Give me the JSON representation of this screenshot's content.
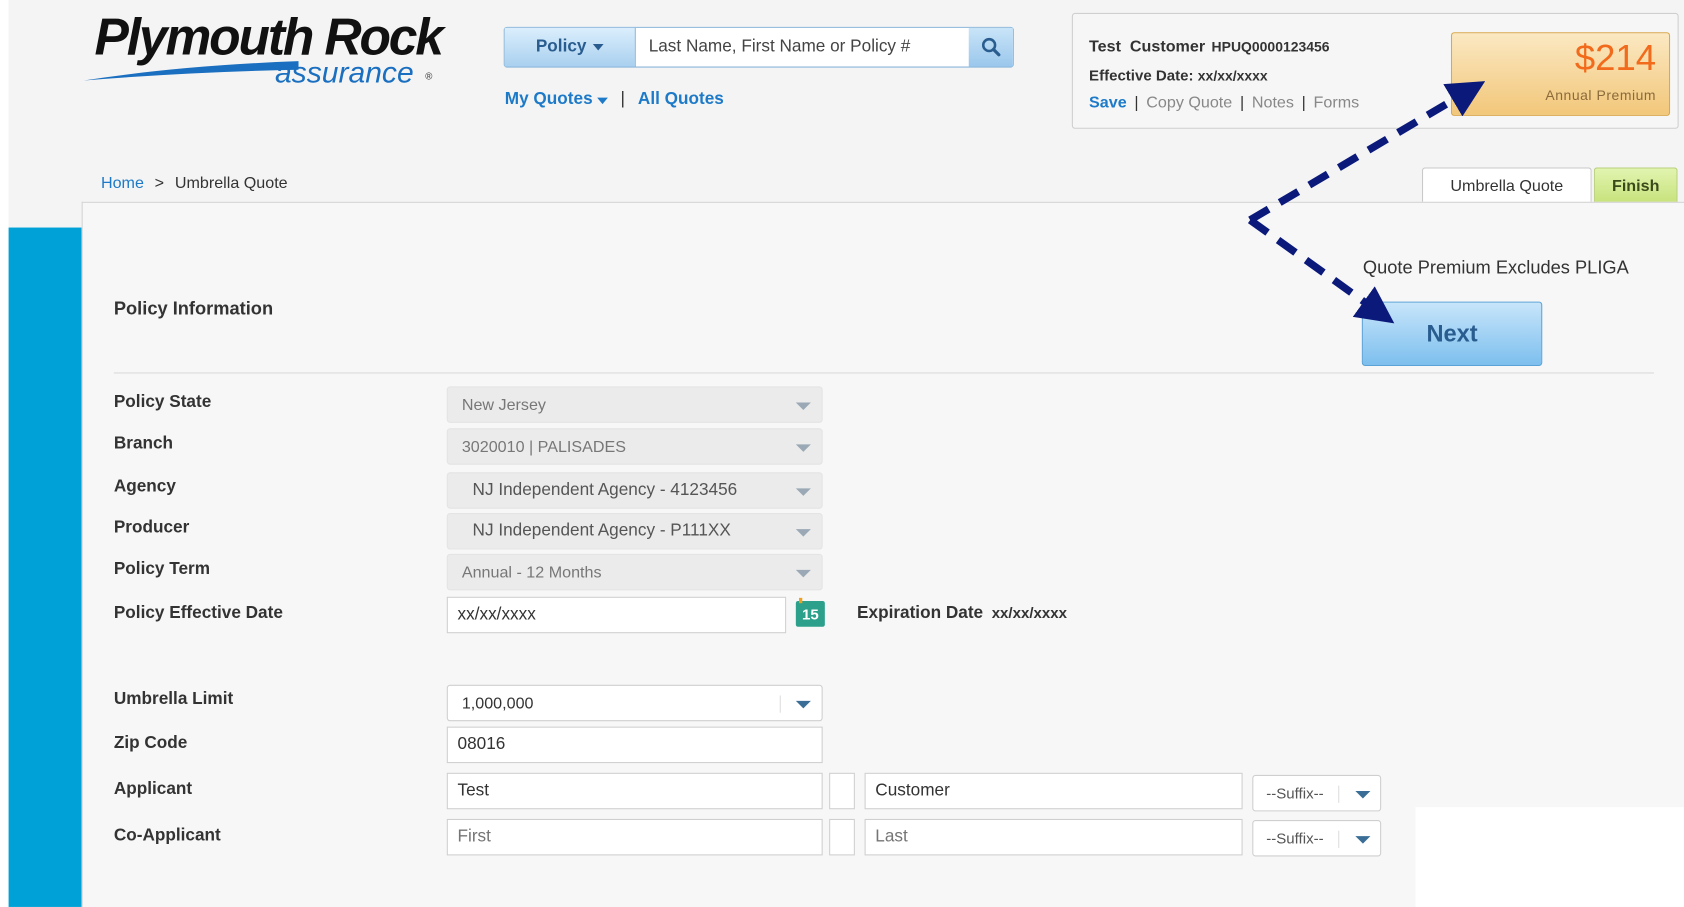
{
  "brand": {
    "logo_main": "Plymouth Rock",
    "logo_sub": "assurance",
    "logo_mark": "®"
  },
  "search": {
    "policy_label": "Policy",
    "placeholder": "Last Name, First Name or Policy #",
    "icon": "search-icon"
  },
  "nav": {
    "my_quotes": "My Quotes",
    "separator": "|",
    "all_quotes": "All Quotes"
  },
  "customer": {
    "name": "Test  Customer",
    "policy_number": "HPUQ0000123456",
    "effective_label": "Effective Date:",
    "effective_value": "xx/xx/xxxx",
    "links": {
      "save": "Save",
      "copy": "Copy Quote",
      "notes": "Notes",
      "forms": "Forms",
      "sep": "|"
    },
    "premium_amount": "$214",
    "premium_label": "Annual Premium"
  },
  "breadcrumb": {
    "home": "Home",
    "sep": ">",
    "current": "Umbrella Quote"
  },
  "tabs": {
    "umbrella": "Umbrella Quote",
    "finish": "Finish"
  },
  "form": {
    "section_title": "Policy Information",
    "excludes_note": "Quote Premium Excludes PLIGA",
    "next_label": "Next",
    "fields": {
      "policy_state": {
        "label": "Policy State",
        "value": "New Jersey"
      },
      "branch": {
        "label": "Branch",
        "value": "3020010 | PALISADES"
      },
      "agency": {
        "label": "Agency",
        "value": "NJ Independent Agency - 4123456"
      },
      "producer": {
        "label": "Producer",
        "value": "NJ Independent Agency - P111XX"
      },
      "policy_term": {
        "label": "Policy Term",
        "value": "Annual - 12 Months"
      },
      "effective_date": {
        "label": "Policy Effective Date",
        "value": "xx/xx/xxxx",
        "calendar_day": "15"
      },
      "expiration": {
        "label": "Expiration Date",
        "value": "xx/xx/xxxx"
      },
      "umbrella_limit": {
        "label": "Umbrella Limit",
        "value": "1,000,000"
      },
      "zip": {
        "label": "Zip Code",
        "value": "08016"
      },
      "applicant": {
        "label": "Applicant",
        "first": "Test",
        "last": "Customer",
        "suffix": "--Suffix--"
      },
      "co_applicant": {
        "label": "Co-Applicant",
        "first_placeholder": "First",
        "last_placeholder": "Last",
        "suffix": "--Suffix--"
      }
    }
  },
  "colors": {
    "accent_blue": "#1d7ac8",
    "side_bar": "#00a1d6",
    "premium_orange": "#f26a1b",
    "annotation_arrow": "#0b1a7a"
  }
}
